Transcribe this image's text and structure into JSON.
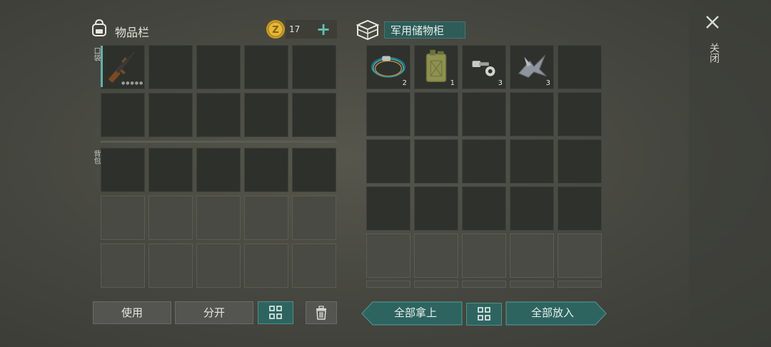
{
  "inventory": {
    "title": "物品栏",
    "icon": "backpack-icon",
    "currency": {
      "value": "17",
      "plus_label": "+",
      "icon": "coin-icon"
    },
    "pocket_label": "口袋",
    "backpack_label": "背包",
    "weapon_slot": {
      "item": "assault-rifle",
      "icon": "rifle-icon"
    }
  },
  "storage": {
    "title": "军用储物柜",
    "icon": "storage-box-icon",
    "items": [
      {
        "name": "wire-coil",
        "icon": "wire-icon",
        "qty": "2"
      },
      {
        "name": "jerry-can",
        "icon": "jerrycan-icon",
        "qty": "1"
      },
      {
        "name": "bolt-and-nut",
        "icon": "bolt-icon",
        "qty": "3"
      },
      {
        "name": "scrap-metal",
        "icon": "scrap-icon",
        "qty": "3"
      }
    ]
  },
  "close": {
    "label": "关闭",
    "icon": "close-icon"
  },
  "actions": {
    "use": "使用",
    "split": "分开",
    "take_all": "全部拿上",
    "put_all": "全部放入"
  },
  "colors": {
    "accent": "#2e6460",
    "plus": "#5fc2b3",
    "cell_dark": "#2e302c",
    "cell_light": "#494a43"
  }
}
